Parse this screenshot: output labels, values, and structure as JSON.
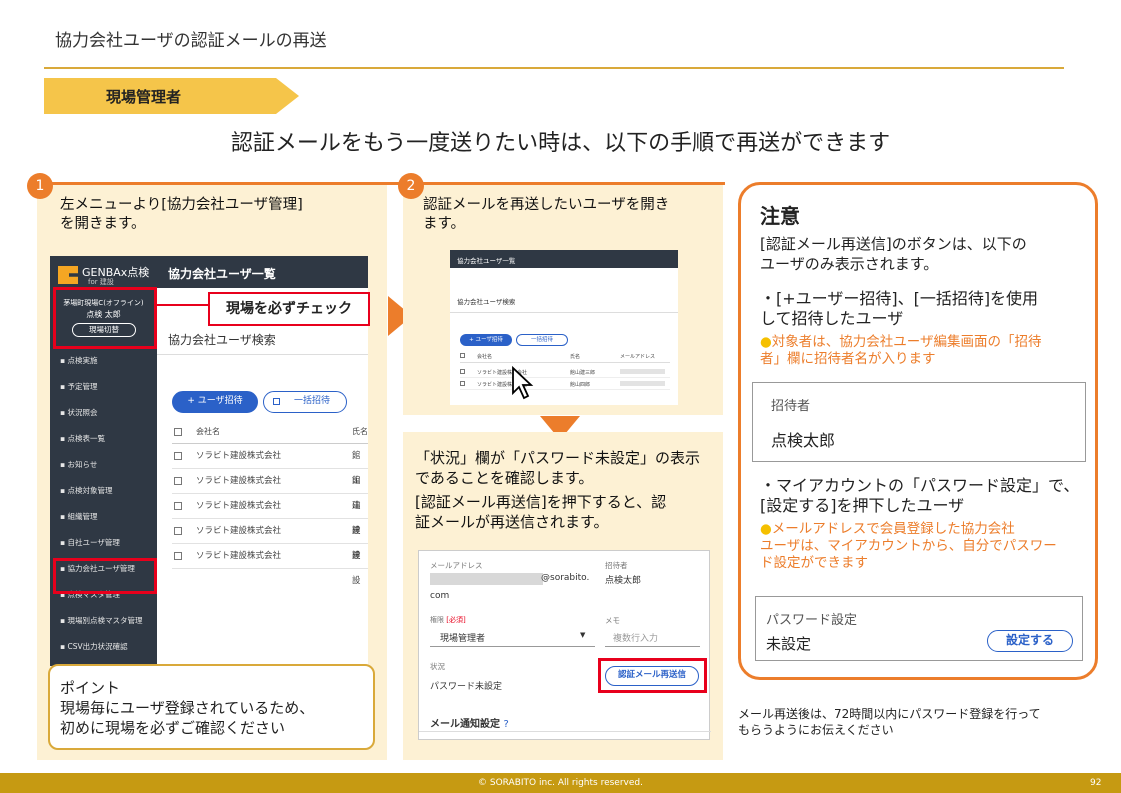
{
  "page_title": "協力会社ユーザの認証メールの再送",
  "role_tab": "現場管理者",
  "subtitle": "認証メールをもう一度送りたい時は、以下の手順で再送ができます",
  "step1": {
    "number": "1",
    "text_l1": "左メニューより[協力会社ユーザ管理]",
    "text_l2": "を開きます。",
    "callout": "現場を必ずチェック",
    "app": {
      "logo": "GENBAx点検",
      "logo_sub": "for 建設",
      "site_l1": "茅場町現場C(オフライン)",
      "site_l2": "点検 太郎",
      "site_switch": "現場切替",
      "header": "協力会社ユーザ一覧",
      "search_title": "協力会社ユーザ検索",
      "menu": [
        "点検実施",
        "予定管理",
        "状況照会",
        "点検表一覧",
        "お知らせ",
        "点検対象管理",
        "組織管理",
        "自社ユーザ管理",
        "協力会社ユーザ管理",
        "点検マスタ管理",
        "現場別点検マスタ管理",
        "CSV出力状況確認"
      ],
      "invite_btn": "+ ユーザ招待",
      "bulk_btn": "一括招待",
      "col_company": "会社名",
      "col_name": "氏名",
      "rows": [
        {
          "company": "ソラビト建設株式会社",
          "name": "館山"
        },
        {
          "company": "ソラビト建設株式会社",
          "name": "館山"
        },
        {
          "company": "ソラビト建設株式会社",
          "name": "建設"
        },
        {
          "company": "ソラビト建設株式会社",
          "name": "建設"
        },
        {
          "company": "ソラビト建設株式会社",
          "name": "建設"
        }
      ]
    },
    "point_title": "ポイント",
    "point_l1": "現場毎にユーザ登録されているため、",
    "point_l2": "初めに現場を必ずご確認ください"
  },
  "step2": {
    "number": "2",
    "text_l1": "認証メールを再送したいユーザを開き",
    "text_l2": "ます。",
    "mini": {
      "header": "協力会社ユーザ一覧",
      "search": "協力会社ユーザ検索",
      "invite_btn": "+ ユーザ招待",
      "bulk_btn": "一括招待",
      "col_company": "会社名",
      "col_name": "氏名",
      "col_mail": "メールアドレス",
      "rows": [
        {
          "company": "ソラビト建設株式会社",
          "name": "館山建三郎"
        },
        {
          "company": "ソラビト建設株式会社",
          "name": "館山四郎"
        }
      ]
    }
  },
  "step3": {
    "text_l1": "「状況」欄が「パスワード未設定」の表示",
    "text_l2": "であることを確認します。",
    "text_l3": "[認証メール再送信]を押下すると、認",
    "text_l4": "証メールが再送信されます。",
    "form": {
      "mail_label": "メールアドレス",
      "mail_value": "@sorabito.",
      "mail_value2": "com",
      "inviter_label": "招待者",
      "inviter_value": "点検太郎",
      "role_label": "権限",
      "required": "[必須]",
      "role_value": "現場管理者",
      "memo_label": "メモ",
      "memo_placeholder": "複数行入力",
      "status_label": "状況",
      "status_value": "パスワード未設定",
      "resend_btn": "認証メール再送信",
      "notify_title": "メール通知設定"
    }
  },
  "note": {
    "title": "注意",
    "intro_l1": "[認証メール再送信]のボタンは、以下の",
    "intro_l2": "ユーザのみ表示されます。",
    "case1_l1": "・[+ユーザー招待]、[一括招待]を使用",
    "case1_l2": "して招待したユーザ",
    "case1_tip_l1": "対象者は、協力会社ユーザ編集画面の「招待",
    "case1_tip_l2": "者」欄に招待者名が入ります",
    "inviter_box_label": "招待者",
    "inviter_box_value": "点検太郎",
    "case2_l1": "・マイアカウントの「パスワード設定」で、",
    "case2_l2": "[設定する]を押下したユーザ",
    "case2_tip_l1": "メールアドレスで会員登録した協力会社",
    "case2_tip_l2": "ユーザは、マイアカウントから、自分でパスワー",
    "case2_tip_l3": "ド設定ができます",
    "pw_box_label": "パスワード設定",
    "pw_box_value": "未設定",
    "pw_box_btn": "設定する"
  },
  "after_note_l1": "メール再送後は、72時間以内にパスワード登録を行って",
  "after_note_l2": "もらうようにお伝えください",
  "footer": "© SORABITO inc. All rights reserved.",
  "page_number": "92",
  "colors": {
    "accent": "#ec7d2b",
    "gold": "#c69a12",
    "tab": "#f5c54a",
    "panel": "#fdf1d4",
    "red": "#e8001c",
    "blue": "#2b61c8"
  }
}
